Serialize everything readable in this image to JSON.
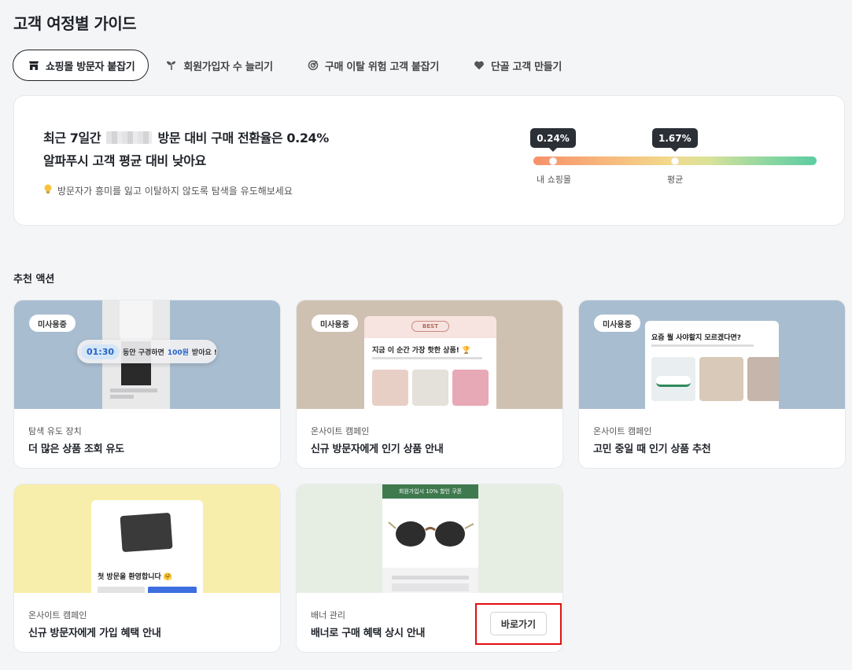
{
  "page": {
    "title": "고객 여정별 가이드"
  },
  "tabs": [
    {
      "label": "쇼핑몰 방문자 붙잡기",
      "icon": "store-icon",
      "active": true
    },
    {
      "label": "회원가입자 수 늘리기",
      "icon": "sprout-icon",
      "active": false
    },
    {
      "label": "구매 이탈 위험 고객 붙잡기",
      "icon": "target-icon",
      "active": false
    },
    {
      "label": "단골 고객 만들기",
      "icon": "heart-icon",
      "active": false
    }
  ],
  "summary": {
    "line1_prefix": "최근 7일간",
    "line1_suffix": "방문 대비 구매 전환율은 0.24%",
    "line2": "알파푸시 고객 평균 대비 낮아요",
    "hint": "방문자가 흥미를 잃고 이탈하지 않도록 탐색을 유도해보세요",
    "hint_icon": "lightbulb-icon",
    "gauge": {
      "mine_value": "0.24%",
      "mine_label": "내 쇼핑몰",
      "mine_fraction": 0.07,
      "avg_value": "1.67%",
      "avg_label": "평균",
      "avg_fraction": 0.5,
      "colors": [
        "#f7906a",
        "#f3d98c",
        "#5ccca3"
      ]
    }
  },
  "section_title": "추천 액션",
  "cards": [
    {
      "badge": "미사용중",
      "category": "탐색 유도 장치",
      "title": "더 많은 상품 조회 유도",
      "thumb_bg": "#a9bdd0",
      "preview": {
        "timer": "01:30",
        "text_a": "동안 구경하면",
        "highlight": "100원",
        "text_b": "받아요 !"
      }
    },
    {
      "badge": "미사용중",
      "category": "온사이트 캠페인",
      "title": "신규 방문자에게 인기 상품 안내",
      "thumb_bg": "#cfc1b2",
      "preview": {
        "logo": "BEST",
        "heading": "지금 이 순간 가장 핫한 상품! 🏆"
      }
    },
    {
      "badge": "미사용중",
      "category": "온사이트 캠페인",
      "title": "고민 중일 때 인기 상품 추천",
      "thumb_bg": "#a9bdd0",
      "preview": {
        "heading": "요즘 뭘 사야할지 모르겠다면?"
      }
    },
    {
      "category": "온사이트 캠페인",
      "title": "신규 방문자에게 가입 혜택 안내",
      "thumb_bg": "#f8eeab",
      "preview": {
        "heading": "첫 방문을 환영합니다 🤗"
      }
    },
    {
      "category": "배너 관리",
      "title": "배너로 구매 혜택 상시 안내",
      "thumb_bg": "#e6eee4",
      "preview": {
        "banner": "회원가입시 10% 할인 쿠폰"
      },
      "action_label": "바로가기"
    }
  ]
}
